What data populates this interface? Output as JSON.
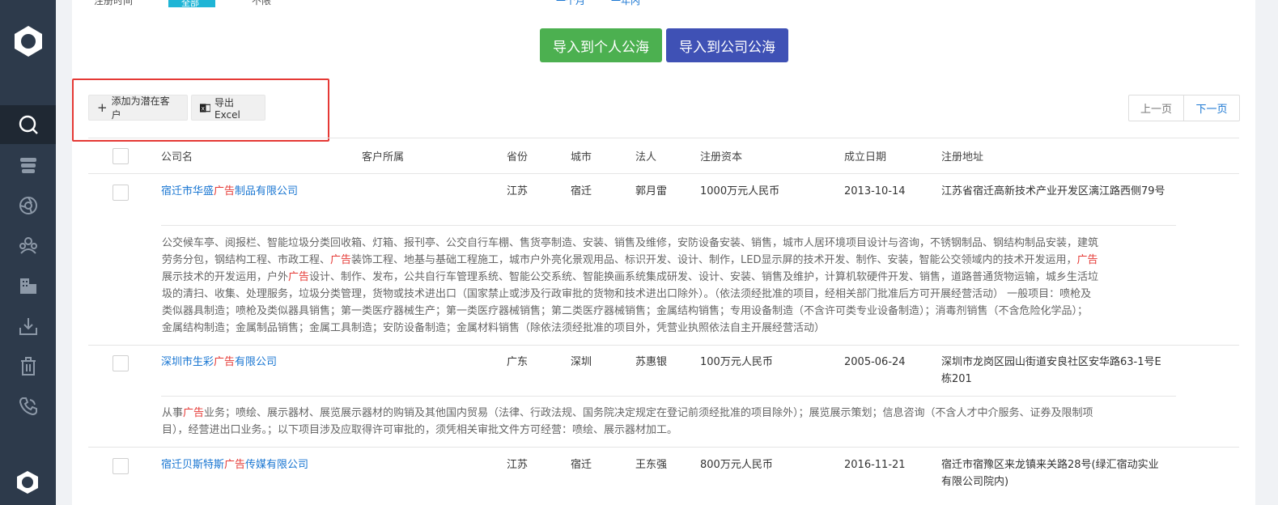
{
  "top_strip": {
    "left_text": "注册时间",
    "chip_text": "全部",
    "middle_text": "不限",
    "right_text_1": "一个月",
    "right_text_2": "一年内"
  },
  "actions": {
    "import_personal": "导入到个人公海",
    "import_company": "导入到公司公海"
  },
  "toolbar": {
    "add_label": "添加为潜在客户",
    "export_label": "导出Excel"
  },
  "pager": {
    "prev": "上一页",
    "next": "下一页"
  },
  "columns": [
    "公司名",
    "客户所属",
    "省份",
    "城市",
    "法人",
    "注册资本",
    "成立日期",
    "注册地址"
  ],
  "rows": [
    {
      "name_pre": "宿迁市华盛",
      "name_hl": "广告",
      "name_post": "制品有限公司",
      "owner": "",
      "province": "江苏",
      "city": "宿迁",
      "legal": "郭月雷",
      "capital": "1000万元人民币",
      "date": "2013-10-14",
      "address": "江苏省宿迁高新技术产业开发区漓江路西侧79号",
      "desc_lines": [
        [
          "公交候车亭、阅报栏、智能垃圾分类回收箱、灯箱、报刊亭、公交自行车棚、售货亭制造、安装、销售及维修，安防设备安装、销售，城市人居环境项目设计与咨询，不锈钢制品、钢结构制品安装，建筑"
        ],
        [
          "劳务分包，钢结构工程、市政工程、",
          "广告",
          "装饰工程、地基与基础工程施工，城市户外亮化景观用品、标识开发、设计、制作，LED显示屏的技术开发、制作、安装，智能公交领域内的技术开发运用，",
          "广告"
        ],
        [
          "展示技术的开发运用，户外",
          "广告",
          "设计、制作、发布，公共自行车管理系统、智能公交系统、智能换画系统集成研发、设计、安装、销售及维护，计算机软硬件开发、销售，道路普通货物运输，城乡生活垃"
        ],
        [
          "圾的清扫、收集、处理服务，垃圾分类管理，货物或技术进出口（国家禁止或涉及行政审批的货物和技术进出口除外）。（依法须经批准的项目，经相关部门批准后方可开展经营活动） 一般项目：喷枪及"
        ],
        [
          "类似器具制造；喷枪及类似器具销售；第一类医疗器械生产；第一类医疗器械销售；第二类医疗器械销售；金属结构销售；专用设备制造（不含许可类专业设备制造）；消毒剂销售（不含危险化学品）；"
        ],
        [
          "金属结构制造；金属制品销售；金属工具制造；安防设备制造；金属材料销售（除依法须经批准的项目外，凭营业执照依法自主开展经营活动）"
        ]
      ]
    },
    {
      "name_pre": "深圳市生彩",
      "name_hl": "广告",
      "name_post": "有限公司",
      "owner": "",
      "province": "广东",
      "city": "深圳",
      "legal": "苏惠银",
      "capital": "100万元人民币",
      "date": "2005-06-24",
      "address": "深圳市龙岗区园山街道安良社区安华路63-1号E栋201",
      "desc_lines": [
        [
          "从事",
          "广告",
          "业务；喷绘、展示器材、展览展示器材的购销及其他国内贸易（法律、行政法规、国务院决定规定在登记前须经批准的项目除外）；展览展示策划；信息咨询（不含人才中介服务、证券及限制项"
        ],
        [
          "目），经营进出口业务。；以下项目涉及应取得许可审批的，须凭相关审批文件方可经营：喷绘、展示器材加工。"
        ]
      ]
    },
    {
      "name_pre": "宿迁贝斯特斯",
      "name_hl": "广告",
      "name_post": "传媒有限公司",
      "owner": "",
      "province": "江苏",
      "city": "宿迁",
      "legal": "王东强",
      "capital": "800万元人民币",
      "date": "2016-11-21",
      "address": "宿迁市宿豫区来龙镇来关路28号(绿汇宿动实业有限公司院内)",
      "desc_lines": []
    }
  ],
  "icons": [
    "logo-icon",
    "search-icon",
    "database-icon",
    "aperture-icon",
    "group-icon",
    "building-icon",
    "download-icon",
    "trash-icon",
    "phone-icon",
    "arrow-up-icon",
    "excel-icon",
    "plus-icon"
  ]
}
